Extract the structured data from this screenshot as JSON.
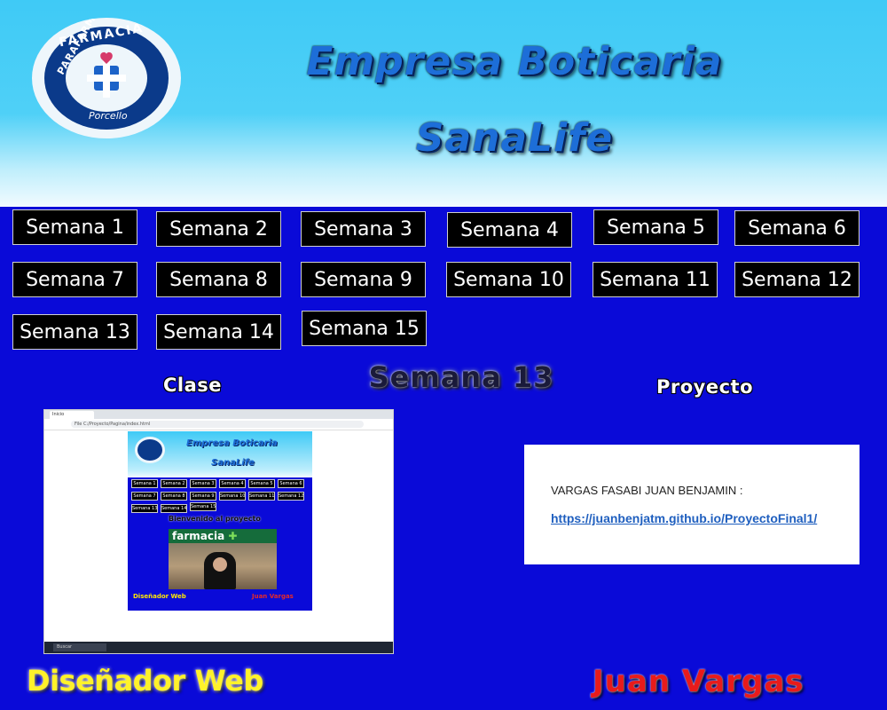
{
  "header": {
    "title_line1": "Empresa Boticaria",
    "title_line2": "SanaLife"
  },
  "logo": {
    "top_text": "FARMACIA",
    "ring_text": "PARAFARMACIA",
    "bottom_text": "Porcello"
  },
  "weeks": [
    "Semana 1",
    "Semana 2",
    "Semana 3",
    "Semana 4",
    "Semana 5",
    "Semana 6",
    "Semana 7",
    "Semana 8",
    "Semana 9",
    "Semana 10",
    "Semana 11",
    "Semana 12",
    "Semana 13",
    "Semana 14",
    "Semana 15"
  ],
  "section": {
    "clase_label": "Clase",
    "current_week": "Semana 13",
    "proyecto_label": "Proyecto"
  },
  "screenshot": {
    "tab_title": "Inicio",
    "url": "File  C:/Proyecto/Pagina/index.html",
    "taskbar_search": "Buscar",
    "title1": "Empresa Boticaria",
    "title2": "SanaLife",
    "weeks": [
      "Semana 1",
      "Semana 2",
      "Semana 3",
      "Semana 4",
      "Semana 5",
      "Semana 6",
      "Semana 7",
      "Semana 8",
      "Semana 9",
      "Semana 10",
      "Semana 11",
      "Semana 12",
      "Semana 13",
      "Semana 14",
      "Semana 15"
    ],
    "welcome": "Bienvenido al proyecto",
    "pharmacy_sign": "farmacia",
    "footer_left": "Diseñador Web",
    "footer_right": "Juan Vargas"
  },
  "project_card": {
    "author": "VARGAS FASABI JUAN BENJAMIN :",
    "link": "https://juanbenjatm.github.io/ProyectoFinal1/"
  },
  "footer": {
    "left": "Diseñador Web",
    "right": "Juan Vargas"
  },
  "colors": {
    "page_bg": "#0a0ad8",
    "header_sky": "#3fcaf6",
    "title_blue": "#1d6ed8",
    "footer_yellow": "#fff22a",
    "footer_red": "#e81b1b"
  }
}
